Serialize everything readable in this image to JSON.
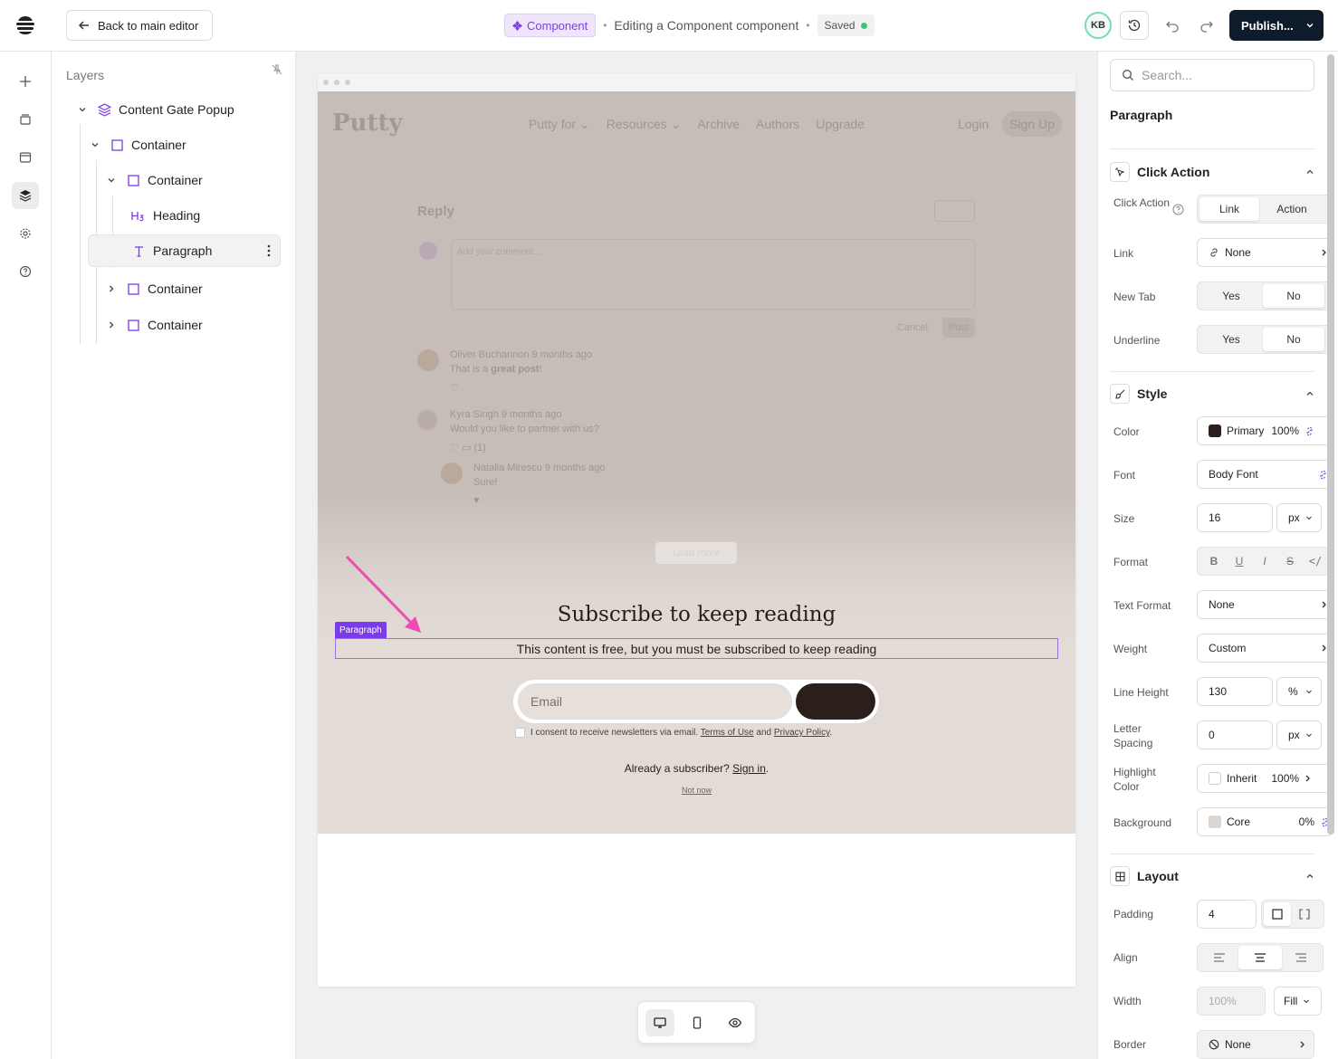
{
  "topbar": {
    "back_label": "Back to main editor",
    "component_badge": "Component",
    "editing_text": "Editing a Component component",
    "saved_label": "Saved",
    "avatar_initials": "KB",
    "publish_label": "Publish..."
  },
  "layers": {
    "title": "Layers",
    "items": [
      {
        "label": "Content Gate Popup",
        "icon": "layers-icon"
      },
      {
        "label": "Container",
        "icon": "square-icon"
      },
      {
        "label": "Container",
        "icon": "square-icon"
      },
      {
        "label": "Heading",
        "icon": "h3-icon"
      },
      {
        "label": "Paragraph",
        "icon": "text-icon"
      },
      {
        "label": "Container",
        "icon": "square-icon"
      },
      {
        "label": "Container",
        "icon": "square-icon"
      }
    ]
  },
  "site": {
    "logo": "Putty",
    "nav": [
      "Putty for",
      "Resources",
      "Archive",
      "Authors",
      "Upgrade"
    ],
    "login": "Login",
    "signup": "Sign Up",
    "reply_title": "Reply",
    "comment_placeholder": "Add your comment...",
    "cancel": "Cancel",
    "post": "Post",
    "comments": [
      {
        "name": "Oliver Buchannon",
        "time": "9 months ago",
        "text_before": "That is a ",
        "text_bold": "great post",
        "text_after": "!"
      },
      {
        "name": "Kyra Singh",
        "time": "9 months ago",
        "text": "Would you like to partner with us?",
        "replies": "(1)"
      },
      {
        "name": "Natalia Mirescu",
        "time": "9 months ago",
        "text": "Sure!"
      }
    ],
    "load_more": "Load more",
    "heading": "Subscribe to keep reading",
    "paragraph_tag": "Paragraph",
    "paragraph": "This content is free, but you must be subscribed to keep reading",
    "email_placeholder": "Email",
    "consent_text": "I consent to receive newsletters via email.",
    "terms": "Terms of Use",
    "and": "and",
    "privacy": "Privacy Policy",
    "already": "Already a subscriber?",
    "sign_in": "Sign in",
    "not_now": "Not now"
  },
  "props": {
    "search_placeholder": "Search...",
    "title": "Paragraph",
    "click_action": {
      "header": "Click Action",
      "click_action_label": "Click Action",
      "options": [
        "Link",
        "Action"
      ],
      "link_label": "Link",
      "link_value": "None",
      "new_tab_label": "New Tab",
      "underline_label": "Underline",
      "yes": "Yes",
      "no": "No"
    },
    "style": {
      "header": "Style",
      "color_label": "Color",
      "color_value": "Primary",
      "color_pct": "100%",
      "color_hex": "#2b1f1b",
      "font_label": "Font",
      "font_value": "Body Font",
      "size_label": "Size",
      "size_value": "16",
      "size_unit": "px",
      "format_label": "Format",
      "text_format_label": "Text Format",
      "text_format_value": "None",
      "weight_label": "Weight",
      "weight_value": "Custom",
      "line_height_label": "Line Height",
      "line_height_value": "130",
      "line_height_unit": "%",
      "letter_spacing_label": "Letter Spacing",
      "letter_spacing_value": "0",
      "letter_spacing_unit": "px",
      "highlight_label": "Highlight Color",
      "highlight_value": "Inherit",
      "highlight_pct": "100%",
      "background_label": "Background",
      "background_value": "Core",
      "background_pct": "0%"
    },
    "layout": {
      "header": "Layout",
      "padding_label": "Padding",
      "padding_value": "4",
      "align_label": "Align",
      "width_label": "Width",
      "width_value": "100%",
      "width_mode": "Fill",
      "border_label": "Border",
      "border_value": "None"
    }
  },
  "colors": {
    "accent": "#7c3aed",
    "publish": "#0d1b2a"
  }
}
